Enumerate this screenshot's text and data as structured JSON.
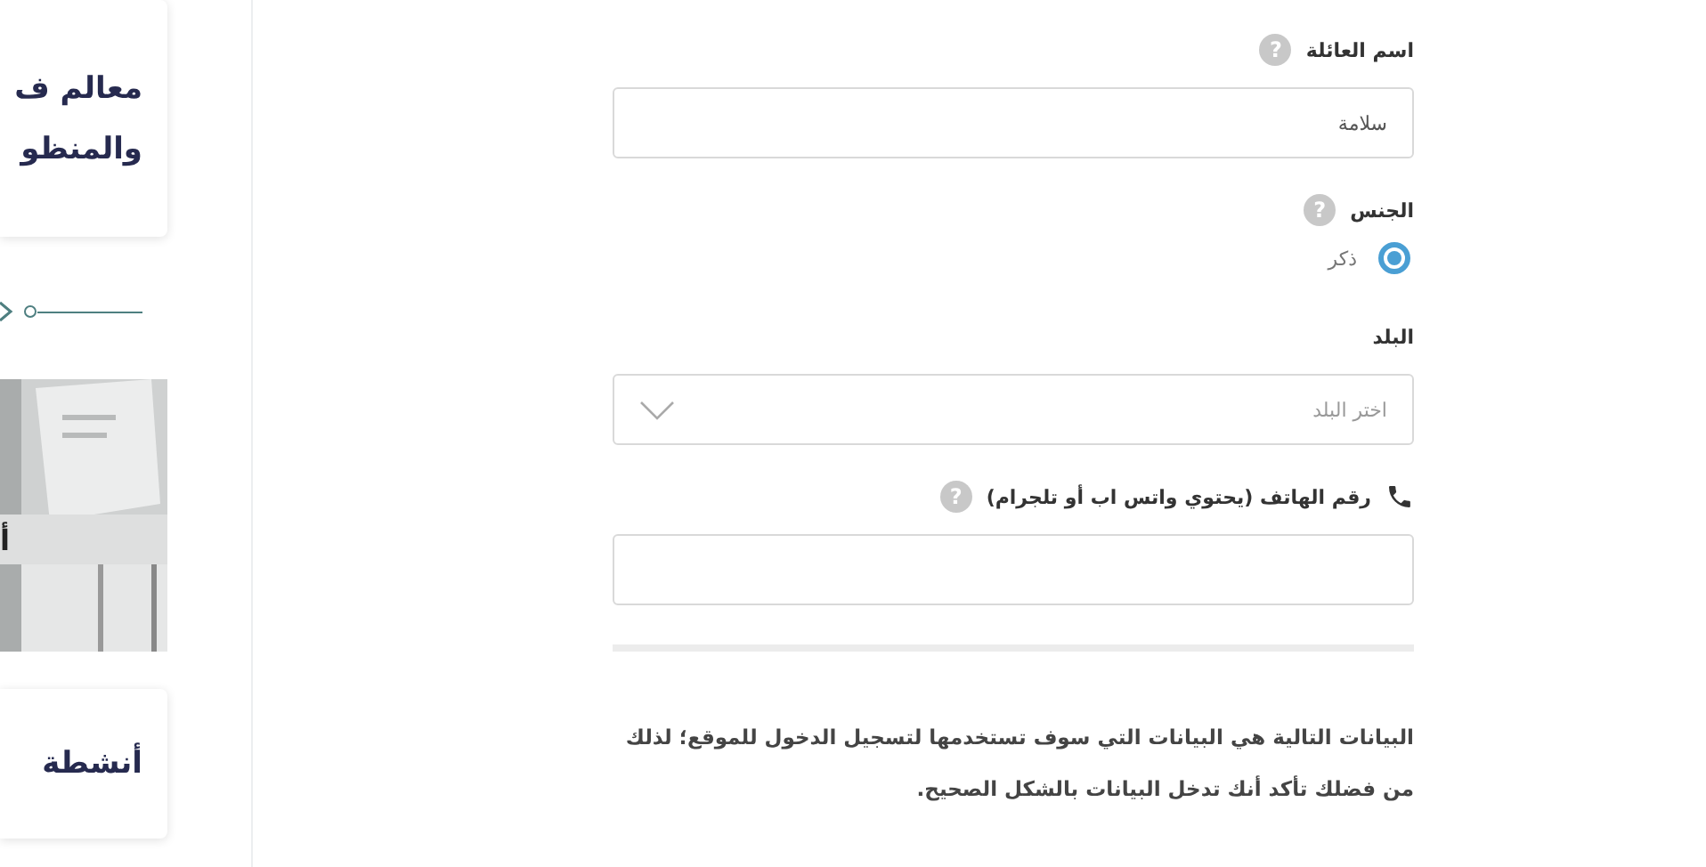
{
  "side_cards": [
    {
      "kind": "text",
      "lines": [
        "معالم ف",
        "والمنظو"
      ]
    },
    {
      "kind": "divider"
    },
    {
      "kind": "picture",
      "caption": "أ"
    },
    {
      "kind": "text",
      "lines": [
        "أنشطة"
      ]
    }
  ],
  "form": {
    "fields": [
      {
        "kind": "text",
        "label": "اسم العائلة",
        "help": "?",
        "value": "سلامة"
      },
      {
        "kind": "radio",
        "label": "الجنس",
        "help": "?",
        "options": [
          {
            "label": "ذكر",
            "selected": true
          }
        ]
      },
      {
        "kind": "select",
        "label": "البلد",
        "placeholder": "اختر البلد"
      },
      {
        "kind": "phone",
        "label": "رقم الهاتف (يحتوي واتس اب أو تلجرام)",
        "help": "?"
      }
    ],
    "note": "البيانات التالية هي البيانات التي سوف تستخدمها لتسجيل الدخول للموقع؛ لذلك من فضلك تأكد أنك تدخل البيانات بالشكل الصحيح."
  }
}
